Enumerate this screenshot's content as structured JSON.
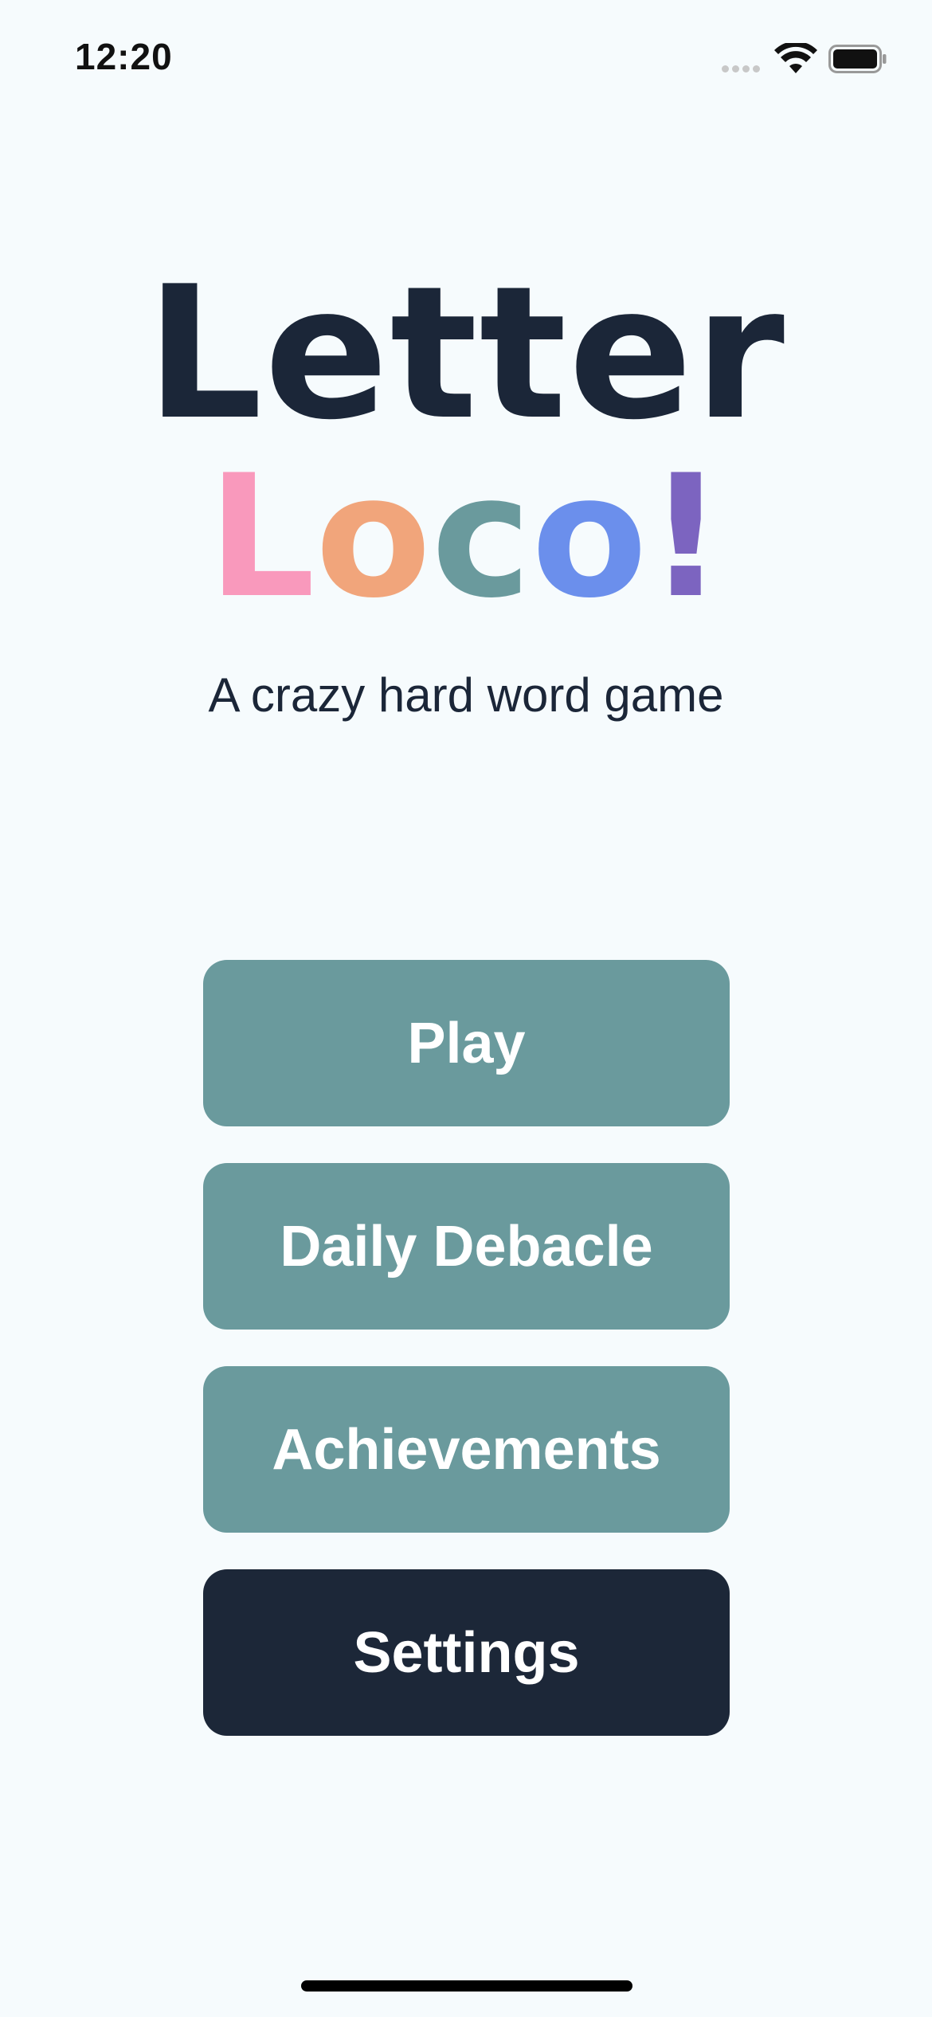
{
  "status_bar": {
    "time": "12:20"
  },
  "logo": {
    "line1": "Letter",
    "line2_letters": [
      {
        "char": "L",
        "color": "#f999bc"
      },
      {
        "char": "o",
        "color": "#f1a57b"
      },
      {
        "char": "c",
        "color": "#6a9a9d"
      },
      {
        "char": "o",
        "color": "#6b8fec"
      },
      {
        "char": "!",
        "color": "#7c64c0"
      }
    ]
  },
  "tagline": "A crazy hard word game",
  "menu": {
    "play": "Play",
    "daily_debacle": "Daily Debacle",
    "achievements": "Achievements",
    "settings": "Settings"
  },
  "colors": {
    "background": "#f6fbfd",
    "primary_dark": "#1c2738",
    "button_teal": "#6a9a9d"
  }
}
